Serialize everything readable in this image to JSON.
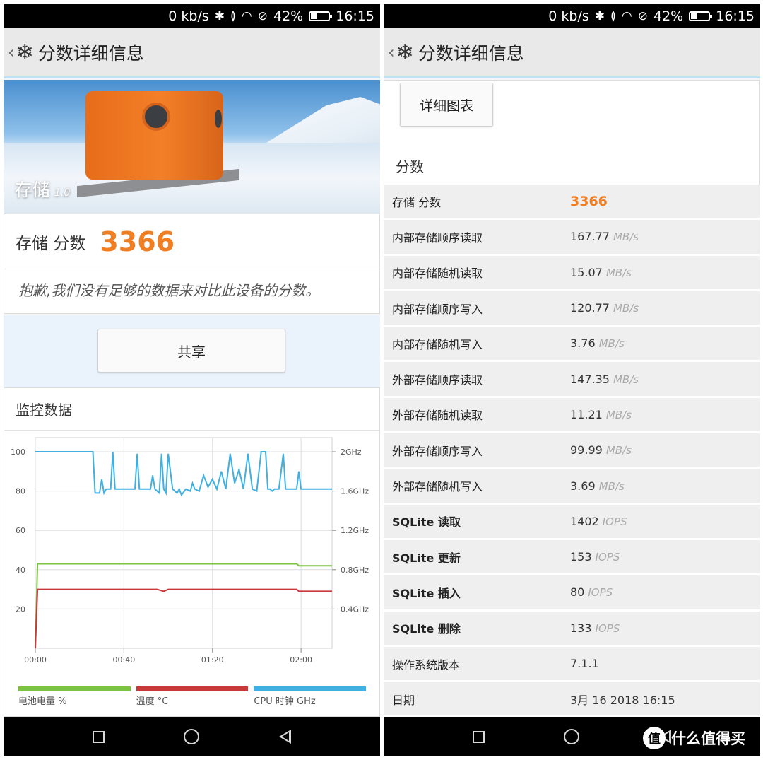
{
  "status": {
    "speed": "0 kb/s",
    "battery": "42%",
    "battery_level": 0.42,
    "time": "16:15",
    "icons": [
      "bluetooth-icon",
      "vibrate-icon",
      "wifi-icon",
      "no-sim-icon"
    ]
  },
  "appbar": {
    "title": "分数详细信息"
  },
  "left": {
    "hero": {
      "label": "存储",
      "version": "1.0"
    },
    "score": {
      "label": "存储 分数",
      "value": "3366"
    },
    "note": "抱歉,我们没有足够的数据来对比此设备的分数。",
    "share_label": "共享",
    "monitor_title": "监控数据",
    "legend": [
      {
        "label": "电池电量 %",
        "color": "#7dc242"
      },
      {
        "label": "温度 °C",
        "color": "#c9383a"
      },
      {
        "label": "CPU 时钟 GHz",
        "color": "#3fb0e0"
      }
    ]
  },
  "chart_data": {
    "type": "line",
    "x_ticks": [
      "00:00",
      "00:40",
      "01:20",
      "02:00"
    ],
    "y_left_ticks": [
      "100",
      "80",
      "60",
      "40",
      "20"
    ],
    "y_right_ticks": [
      "2GHz",
      "1.6GHz",
      "1.2GHz",
      "0.8GHz",
      "0.4GHz"
    ],
    "ylim": [
      0,
      100
    ],
    "x_range_minutes": [
      0,
      134
    ],
    "grid": true,
    "series": [
      {
        "name": "电池电量 %",
        "color": "#7dc242",
        "x": [
          0,
          1,
          118,
          119,
          134
        ],
        "y": [
          0,
          43,
          43,
          42,
          42
        ]
      },
      {
        "name": "温度 °C",
        "color": "#c9383a",
        "x": [
          0,
          1,
          55,
          58,
          60,
          118,
          119,
          134
        ],
        "y": [
          0,
          30,
          30,
          29,
          30,
          30,
          29,
          29
        ]
      },
      {
        "name": "CPU 时钟 GHz",
        "color": "#3fb0e0",
        "x": [
          0,
          26,
          27,
          29,
          30,
          31,
          32,
          34,
          35,
          36,
          40,
          45,
          46,
          47,
          52,
          53,
          54,
          56,
          57,
          58,
          59,
          60,
          62,
          64,
          65,
          66,
          68,
          70,
          71,
          72,
          74,
          76,
          78,
          80,
          82,
          84,
          86,
          88,
          90,
          92,
          94,
          96,
          98,
          100,
          102,
          104,
          105,
          106,
          107,
          108,
          110,
          112,
          113,
          114,
          116,
          118,
          119,
          120,
          122,
          124,
          126,
          134
        ],
        "y": [
          100,
          100,
          79,
          79,
          86,
          79,
          81,
          81,
          100,
          81,
          81,
          81,
          99,
          81,
          81,
          88,
          81,
          79,
          99,
          81,
          79,
          99,
          81,
          79,
          81,
          78,
          81,
          80,
          84,
          81,
          80,
          88,
          82,
          86,
          81,
          90,
          81,
          99,
          84,
          91,
          81,
          99,
          81,
          80,
          100,
          100,
          81,
          81,
          80,
          81,
          81,
          99,
          81,
          81,
          81,
          81,
          90,
          81,
          81,
          81,
          81,
          81
        ]
      }
    ]
  },
  "right": {
    "detail_button": "详细图表",
    "heading": "分数",
    "rows": [
      {
        "label": "存储 分数",
        "value": "3366",
        "unit": ""
      },
      {
        "label": "内部存储顺序读取",
        "value": "167.77",
        "unit": "MB/s"
      },
      {
        "label": "内部存储随机读取",
        "value": "15.07",
        "unit": "MB/s"
      },
      {
        "label": "内部存储顺序写入",
        "value": "120.77",
        "unit": "MB/s"
      },
      {
        "label": "内部存储随机写入",
        "value": "3.76",
        "unit": "MB/s"
      },
      {
        "label": "外部存储顺序读取",
        "value": "147.35",
        "unit": "MB/s"
      },
      {
        "label": "外部存储随机读取",
        "value": "11.21",
        "unit": "MB/s"
      },
      {
        "label": "外部存储顺序写入",
        "value": "99.99",
        "unit": "MB/s"
      },
      {
        "label": "外部存储随机写入",
        "value": "3.69",
        "unit": "MB/s"
      },
      {
        "label": "SQLite 读取",
        "value": "1402",
        "unit": "IOPS"
      },
      {
        "label": "SQLite 更新",
        "value": "153",
        "unit": "IOPS"
      },
      {
        "label": "SQLite 插入",
        "value": "80",
        "unit": "IOPS"
      },
      {
        "label": "SQLite 删除",
        "value": "133",
        "unit": "IOPS"
      },
      {
        "label": "操作系统版本",
        "value": "7.1.1",
        "unit": ""
      },
      {
        "label": "日期",
        "value": "3月 16 2018 16:15",
        "unit": ""
      }
    ]
  },
  "watermark": {
    "logo": "值",
    "text": "什么值得买"
  }
}
